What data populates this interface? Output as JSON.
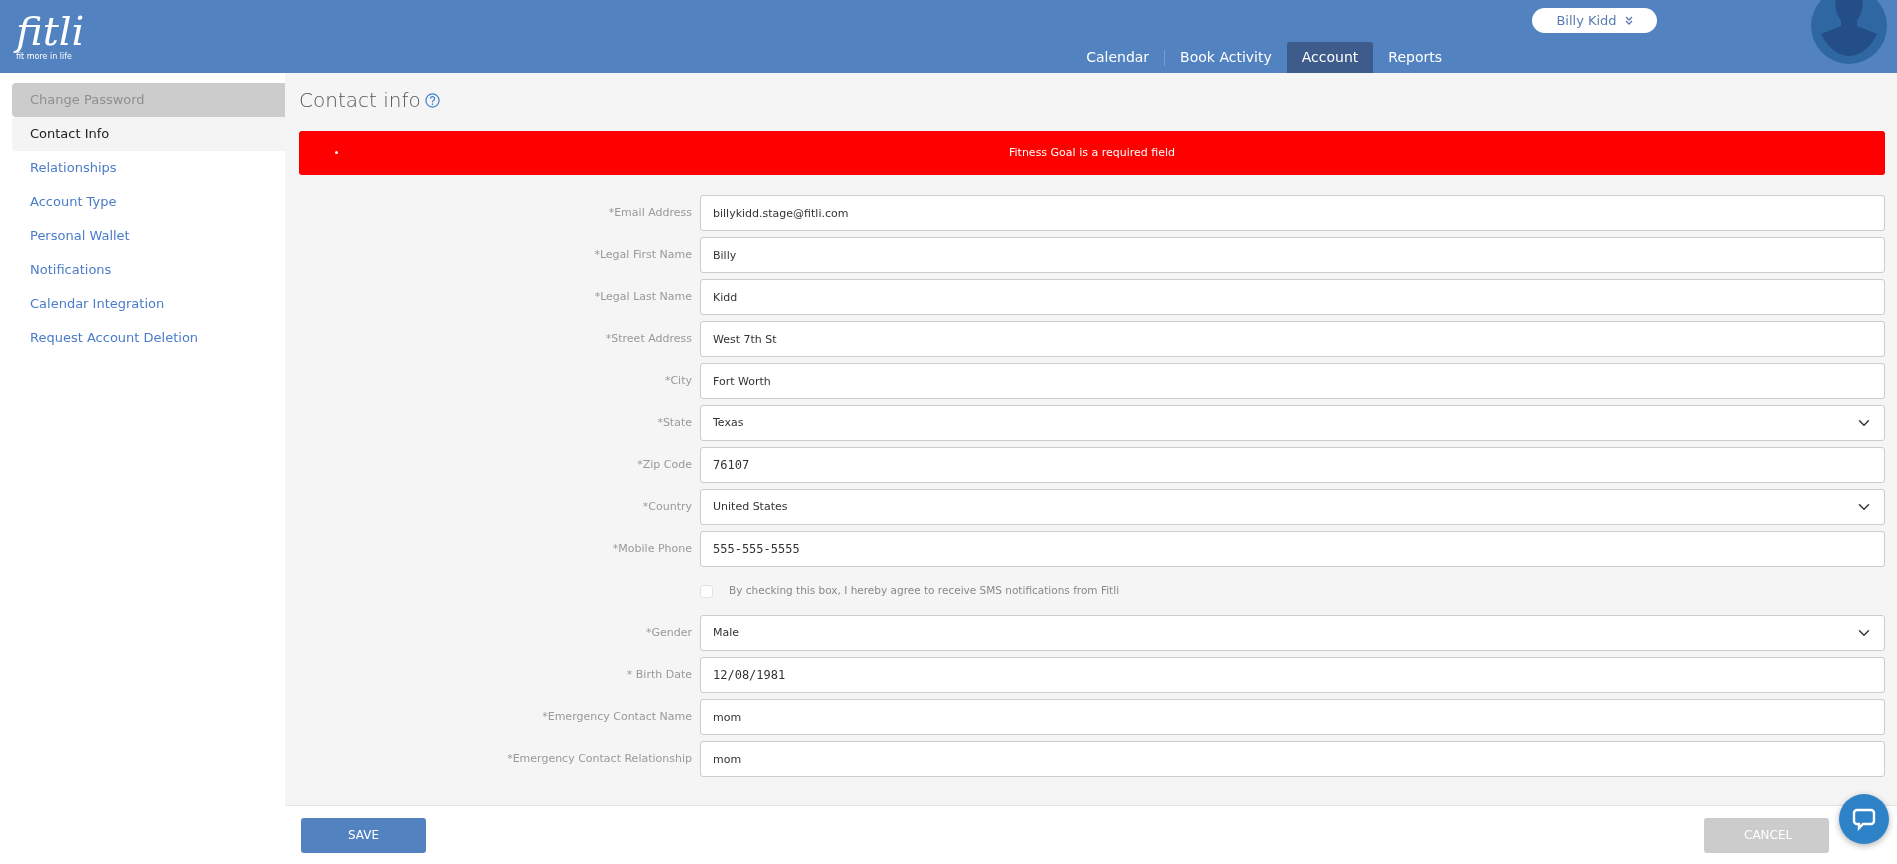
{
  "header": {
    "logo": "fitli",
    "tagline": "fit more in life",
    "user_menu": "Billy Kidd",
    "tabs": [
      {
        "label": "Calendar",
        "selected": false
      },
      {
        "label": "Book Activity",
        "selected": false
      },
      {
        "label": "Account",
        "selected": true
      },
      {
        "label": "Reports",
        "selected": false
      }
    ]
  },
  "sidebar": {
    "items": [
      {
        "label": "Change Password",
        "selected": false,
        "disabled": true
      },
      {
        "label": "Contact Info",
        "selected": true,
        "disabled": false
      },
      {
        "label": "Relationships",
        "selected": false,
        "disabled": false
      },
      {
        "label": "Account Type",
        "selected": false,
        "disabled": false
      },
      {
        "label": "Personal Wallet",
        "selected": false,
        "disabled": false
      },
      {
        "label": "Notifications",
        "selected": false,
        "disabled": false
      },
      {
        "label": "Calendar Integration",
        "selected": false,
        "disabled": false
      },
      {
        "label": "Request Account Deletion",
        "selected": false,
        "disabled": false
      }
    ]
  },
  "page_title": "Contact info",
  "errors": [
    "Fitness Goal is a required field"
  ],
  "fields": [
    {
      "kind": "text",
      "label": "*Email Address",
      "value": "billykidd.stage@fitli.com"
    },
    {
      "kind": "text",
      "label": "*Legal First Name",
      "value": "Billy"
    },
    {
      "kind": "text",
      "label": "*Legal Last Name",
      "value": "Kidd"
    },
    {
      "kind": "text",
      "label": "*Street Address",
      "value": "West 7th St"
    },
    {
      "kind": "text",
      "label": "*City",
      "value": "Fort Worth"
    },
    {
      "kind": "select",
      "label": "*State",
      "value": "Texas"
    },
    {
      "kind": "numeric",
      "label": "*Zip Code",
      "value": "76107"
    },
    {
      "kind": "select",
      "label": "*Country",
      "value": "United States"
    },
    {
      "kind": "numeric",
      "label": "*Mobile Phone",
      "value": "555-555-5555"
    },
    {
      "kind": "checkbox",
      "label": "By checking this box, I hereby agree to receive SMS notifications from Fitli",
      "checked": false
    },
    {
      "kind": "select",
      "label": "*Gender",
      "value": "Male"
    },
    {
      "kind": "numeric",
      "label": "* Birth Date",
      "value": "12/08/1981"
    },
    {
      "kind": "text",
      "label": "*Emergency Contact Name",
      "value": "mom"
    },
    {
      "kind": "text",
      "label": "*Emergency Contact Relationship",
      "value": "mom"
    }
  ],
  "buttons": {
    "save": "SAVE",
    "cancel": "CANCEL"
  }
}
